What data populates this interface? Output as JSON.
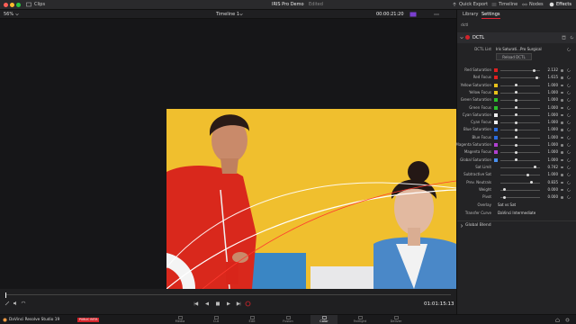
{
  "window": {
    "project_title": "IRIS Pro Demo",
    "edited_label": "Edited"
  },
  "toolbar": {
    "clips_label": "Clips",
    "quick_export": "Quick Export",
    "timeline": "Timeline",
    "nodes": "Nodes",
    "effects": "Effects"
  },
  "viewer": {
    "zoom": "56%",
    "timeline_name": "Timeline 1",
    "timecode_top": "00:00:21:20",
    "timecode_bottom": "01:01:15:13",
    "playhead_progress": 0.0
  },
  "panel": {
    "tabs": [
      "Library",
      "Settings"
    ],
    "active_tab": "Settings",
    "search_text": "dctl",
    "section_title": "DCTL",
    "dctl_list_label": "DCTL List",
    "dctl_list_value": "Iris Saturati...Pro Surgical",
    "reload_label": "Reload DCTL",
    "params": [
      {
        "label": "Red Saturation",
        "color": "#e02020",
        "value": "2.132",
        "knob": 0.85
      },
      {
        "label": "Red Focus",
        "color": "#e02020",
        "value": "1.615",
        "knob": 0.92
      },
      {
        "label": "Yellow Saturation",
        "color": "#e8c21a",
        "value": "1.000",
        "knob": 0.4
      },
      {
        "label": "Yellow Focus",
        "color": "#e8c21a",
        "value": "1.000",
        "knob": 0.4
      },
      {
        "label": "Green Saturation",
        "color": "#2cc02c",
        "value": "1.000",
        "knob": 0.4
      },
      {
        "label": "Green Focus",
        "color": "#2cc02c",
        "value": "1.000",
        "knob": 0.4
      },
      {
        "label": "Cyan Saturation",
        "color": "#f0f0f0",
        "value": "1.000",
        "knob": 0.4
      },
      {
        "label": "Cyan Focus",
        "color": "#f0f0f0",
        "value": "1.000",
        "knob": 0.4
      },
      {
        "label": "Blue Saturation",
        "color": "#2a6ce0",
        "value": "1.000",
        "knob": 0.4
      },
      {
        "label": "Blue Focus",
        "color": "#2a6ce0",
        "value": "1.000",
        "knob": 0.4
      },
      {
        "label": "Magenta Saturation",
        "color": "#b040d0",
        "value": "1.000",
        "knob": 0.4
      },
      {
        "label": "Magenta Focus",
        "color": "#b040d0",
        "value": "1.000",
        "knob": 0.4
      },
      {
        "label": "Global Saturation",
        "color": "#4a90f0",
        "value": "1.000",
        "knob": 0.4
      },
      {
        "label": "Sat Limit",
        "color": "",
        "value": "0.742",
        "knob": 0.88
      },
      {
        "label": "Subtractive Sat",
        "color": "",
        "value": "1.000",
        "knob": 0.7
      },
      {
        "label": "Prev. Neutrals",
        "color": "",
        "value": "0.835",
        "knob": 0.78
      },
      {
        "label": "Weight",
        "color": "",
        "value": "0.000",
        "knob": 0.1
      },
      {
        "label": "Pivot",
        "color": "",
        "value": "0.000",
        "knob": 0.1
      }
    ],
    "overlay_label": "Overlay",
    "overlay_value": "Sat vs Sat",
    "transfer_label": "Transfer Curve",
    "transfer_value": "DaVinci Intermediate",
    "global_blend": "Global Blend"
  },
  "bottom": {
    "app_name": "DaVinci Resolve Studio 19",
    "beta_badge": "PUBLIC BETA",
    "pages": [
      "Media",
      "Cut",
      "Edit",
      "Fusion",
      "Color",
      "Fairlight",
      "Deliver"
    ],
    "active_page": "Color"
  },
  "colors": {
    "accent": "#d2232a",
    "panel": "#232325",
    "photo_bg": "#f0bf2e"
  }
}
